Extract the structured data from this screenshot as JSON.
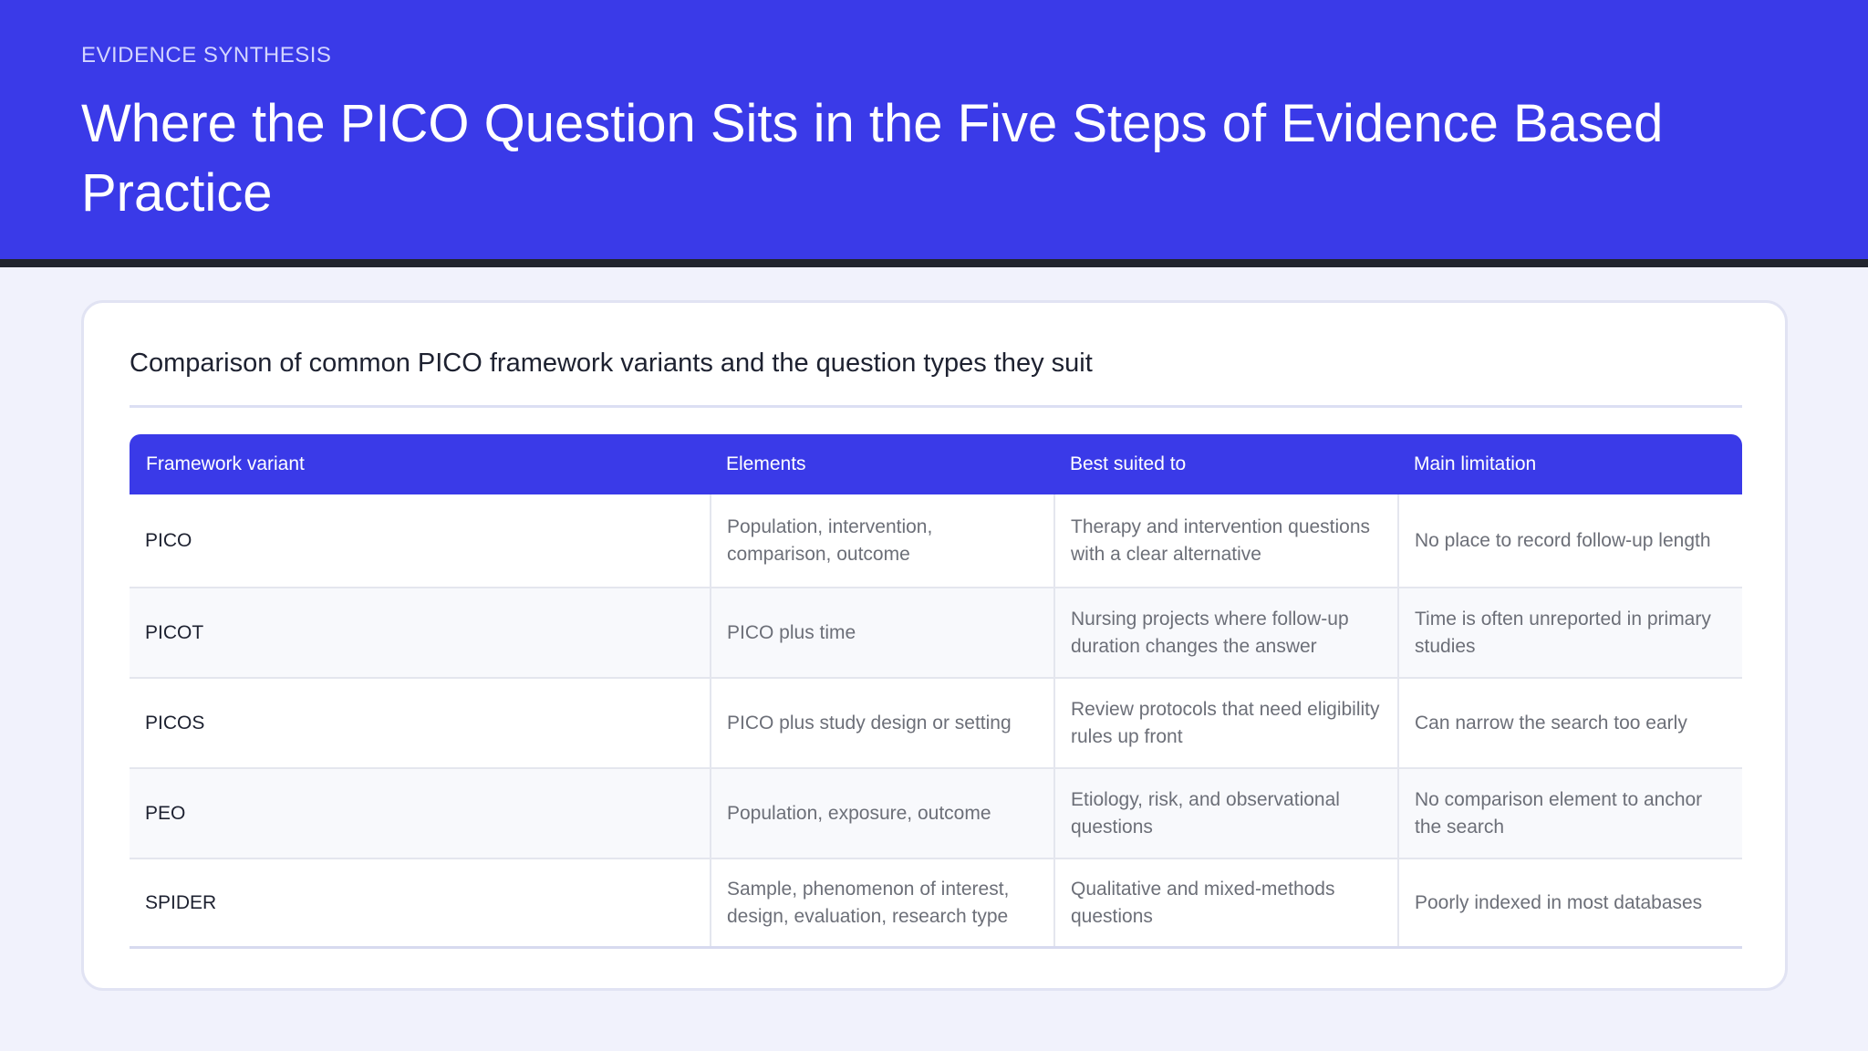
{
  "header": {
    "eyebrow": "EVIDENCE SYNTHESIS",
    "title": "Where the PICO Question Sits in the Five Steps of Evidence Based Practice"
  },
  "card": {
    "title": "Comparison of common PICO framework variants and the question types they suit"
  },
  "table": {
    "columns": [
      "Framework variant",
      "Elements",
      "Best suited to",
      "Main limitation"
    ],
    "rows": [
      [
        "PICO",
        "Population, intervention, comparison, outcome",
        "Therapy and intervention questions with a clear alternative",
        "No place to record follow-up length"
      ],
      [
        "PICOT",
        "PICO plus time",
        "Nursing projects where follow-up duration changes the answer",
        "Time is often unreported in primary studies"
      ],
      [
        "PICOS",
        "PICO plus study design or setting",
        "Review protocols that need eligibility rules up front",
        "Can narrow the search too early"
      ],
      [
        "PEO",
        "Population, exposure, outcome",
        "Etiology, risk, and observational questions",
        "No comparison element to anchor the search"
      ],
      [
        "SPIDER",
        "Sample, phenomenon of interest, design, evaluation, research type",
        "Qualitative and mixed-methods questions",
        "Poorly indexed in most databases"
      ]
    ]
  },
  "colors": {
    "accent": "#3a3ae8",
    "header_rule": "#22252e",
    "page_background": "#f1f2fc"
  }
}
